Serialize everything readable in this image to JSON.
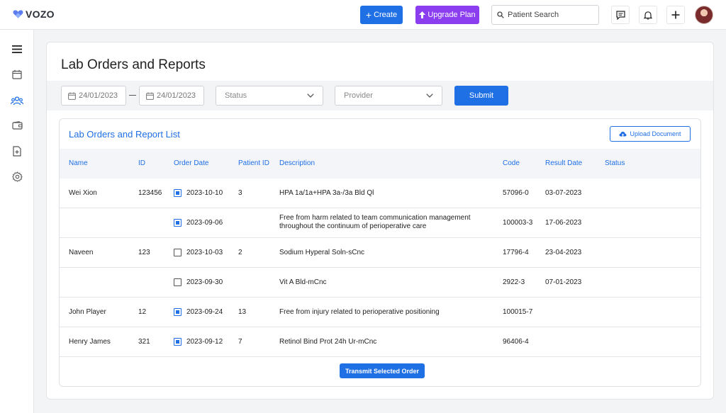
{
  "app": {
    "logo_text": "VOZO"
  },
  "header": {
    "create_label": "Create",
    "upgrade_label": "Upgrade Plan",
    "search_placeholder": "Patient Search",
    "icons": [
      "chat-icon",
      "bell-icon",
      "plus-icon"
    ]
  },
  "sidebar": {
    "items": [
      {
        "icon": "menu-icon"
      },
      {
        "icon": "calendar-icon"
      },
      {
        "icon": "users-icon",
        "active": true
      },
      {
        "icon": "wallet-icon"
      },
      {
        "icon": "document-add-icon"
      },
      {
        "icon": "gear-icon"
      }
    ]
  },
  "page": {
    "title": "Lab Orders and Reports",
    "filters": {
      "date_from": "24/01/2023",
      "date_to": "24/01/2023",
      "status_placeholder": "Status",
      "provider_placeholder": "Provider",
      "submit_label": "Submit"
    }
  },
  "panel": {
    "title": "Lab Orders and Report List",
    "upload_label": "Upload Document",
    "columns": {
      "name": "Name",
      "id": "ID",
      "order_date": "Order Date",
      "patient_id": "Patient ID",
      "description": "Description",
      "code": "Code",
      "result_date": "Result Date",
      "status": "Status"
    },
    "rows": [
      {
        "name": "Wei Xion",
        "id": "123456",
        "checked": true,
        "order_date": "2023-10-10",
        "patient_id": "3",
        "description": "HPA 1a/1a+HPA 3a-/3a Bld Ql",
        "description2": "",
        "code": "57096-0",
        "result_date": "03-07-2023",
        "status": ""
      },
      {
        "name": "",
        "id": "",
        "checked": true,
        "order_date": "2023-09-06",
        "patient_id": "",
        "description": "Free from harm related to team communication management",
        "description2": "throughout the continuum of perioperative care",
        "code": "100003-3",
        "result_date": "17-06-2023",
        "status": ""
      },
      {
        "name": "Naveen",
        "id": "123",
        "checked": false,
        "order_date": "2023-10-03",
        "patient_id": "2",
        "description": "Sodium Hyperal Soln-sCnc",
        "description2": "",
        "code": "17796-4",
        "result_date": "23-04-2023",
        "status": ""
      },
      {
        "name": "",
        "id": "",
        "checked": false,
        "order_date": "2023-09-30",
        "patient_id": "",
        "description": "Vit A Bld-mCnc",
        "description2": "",
        "code": "2922-3",
        "result_date": "07-01-2023",
        "status": ""
      },
      {
        "name": "John Player",
        "id": "12",
        "checked": true,
        "order_date": "2023-09-24",
        "patient_id": "13",
        "description": "Free from injury related to perioperative positioning",
        "description2": "",
        "code": "100015-7",
        "result_date": "",
        "status": ""
      },
      {
        "name": "Henry James",
        "id": "321",
        "checked": true,
        "order_date": "2023-09-12",
        "patient_id": "7",
        "description": "Retinol Bind Prot 24h Ur-mCnc",
        "description2": "",
        "code": "96406-4",
        "result_date": "",
        "status": ""
      }
    ],
    "transmit_label": "Transmit Selected Order"
  },
  "colors": {
    "primary": "#1f6fe5",
    "upgrade": "#8b3df0",
    "background": "#f3f4f6"
  }
}
